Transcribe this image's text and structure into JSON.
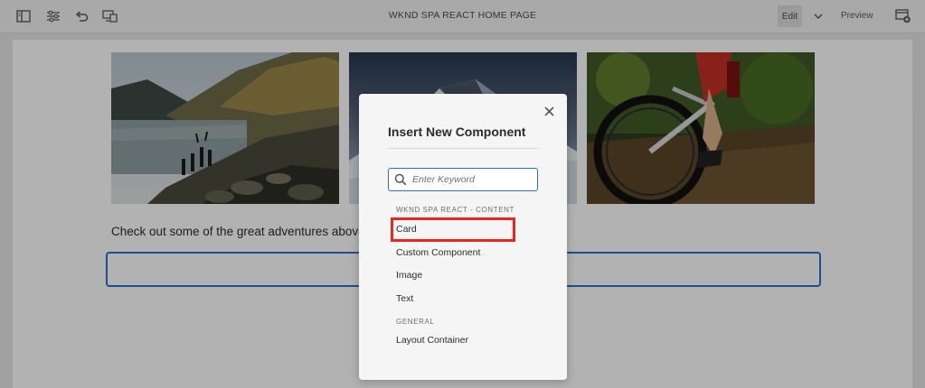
{
  "toolbar": {
    "page_title": "WKND SPA REACT HOME PAGE",
    "edit_label": "Edit",
    "preview_label": "Preview"
  },
  "page": {
    "paragraph": "Check out some of the great adventures above"
  },
  "dialog": {
    "title": "Insert New Component",
    "search_placeholder": "Enter Keyword",
    "groups": [
      {
        "name": "WKND SPA REACT - CONTENT",
        "items": [
          "Card",
          "Custom Component",
          "Image",
          "Text"
        ]
      },
      {
        "name": "GENERAL",
        "items": [
          "Layout Container"
        ]
      }
    ]
  },
  "colors": {
    "accent": "#2d6fd0",
    "highlight": "#e8281c"
  }
}
